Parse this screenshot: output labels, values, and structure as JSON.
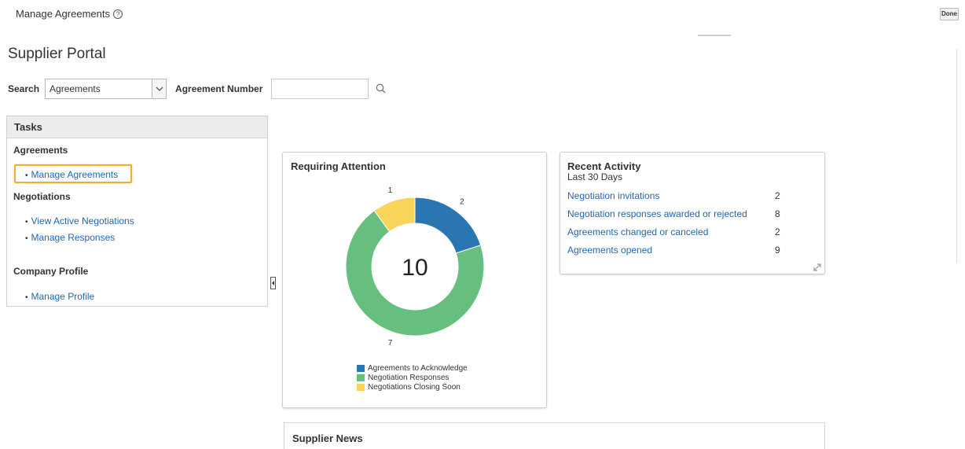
{
  "header": {
    "title": "Manage Agreements",
    "help_icon": "?",
    "done_label": "Done"
  },
  "page": {
    "title": "Supplier Portal"
  },
  "search": {
    "label": "Search",
    "selected": "Agreements",
    "number_label": "Agreement Number",
    "number_value": ""
  },
  "tasks": {
    "title": "Tasks",
    "sections": [
      {
        "heading": "Agreements",
        "links": [
          "Manage Agreements"
        ]
      },
      {
        "heading": "Negotiations",
        "links": [
          "View Active Negotiations",
          "Manage Responses"
        ]
      },
      {
        "heading": "Company Profile",
        "links": [
          "Manage Profile"
        ]
      }
    ],
    "highlighted_link": "Manage Agreements"
  },
  "attention": {
    "title": "Requiring Attention",
    "total": "10",
    "slices": [
      {
        "label": "Agreements to Acknowledge",
        "value": 2,
        "value_label": "2",
        "color": "#2a76b0"
      },
      {
        "label": "Negotiation Responses",
        "value": 7,
        "value_label": "7",
        "color": "#66bf7f"
      },
      {
        "label": "Negotiations Closing Soon",
        "value": 1,
        "value_label": "1",
        "color": "#f8d55a"
      }
    ]
  },
  "activity": {
    "title": "Recent Activity",
    "subtitle": "Last 30 Days",
    "rows": [
      {
        "label": "Negotiation invitations",
        "count": "2"
      },
      {
        "label": "Negotiation responses awarded or rejected",
        "count": "8"
      },
      {
        "label": "Agreements changed or canceled",
        "count": "2"
      },
      {
        "label": "Agreements opened",
        "count": "9"
      }
    ]
  },
  "news": {
    "title": "Supplier News"
  }
}
